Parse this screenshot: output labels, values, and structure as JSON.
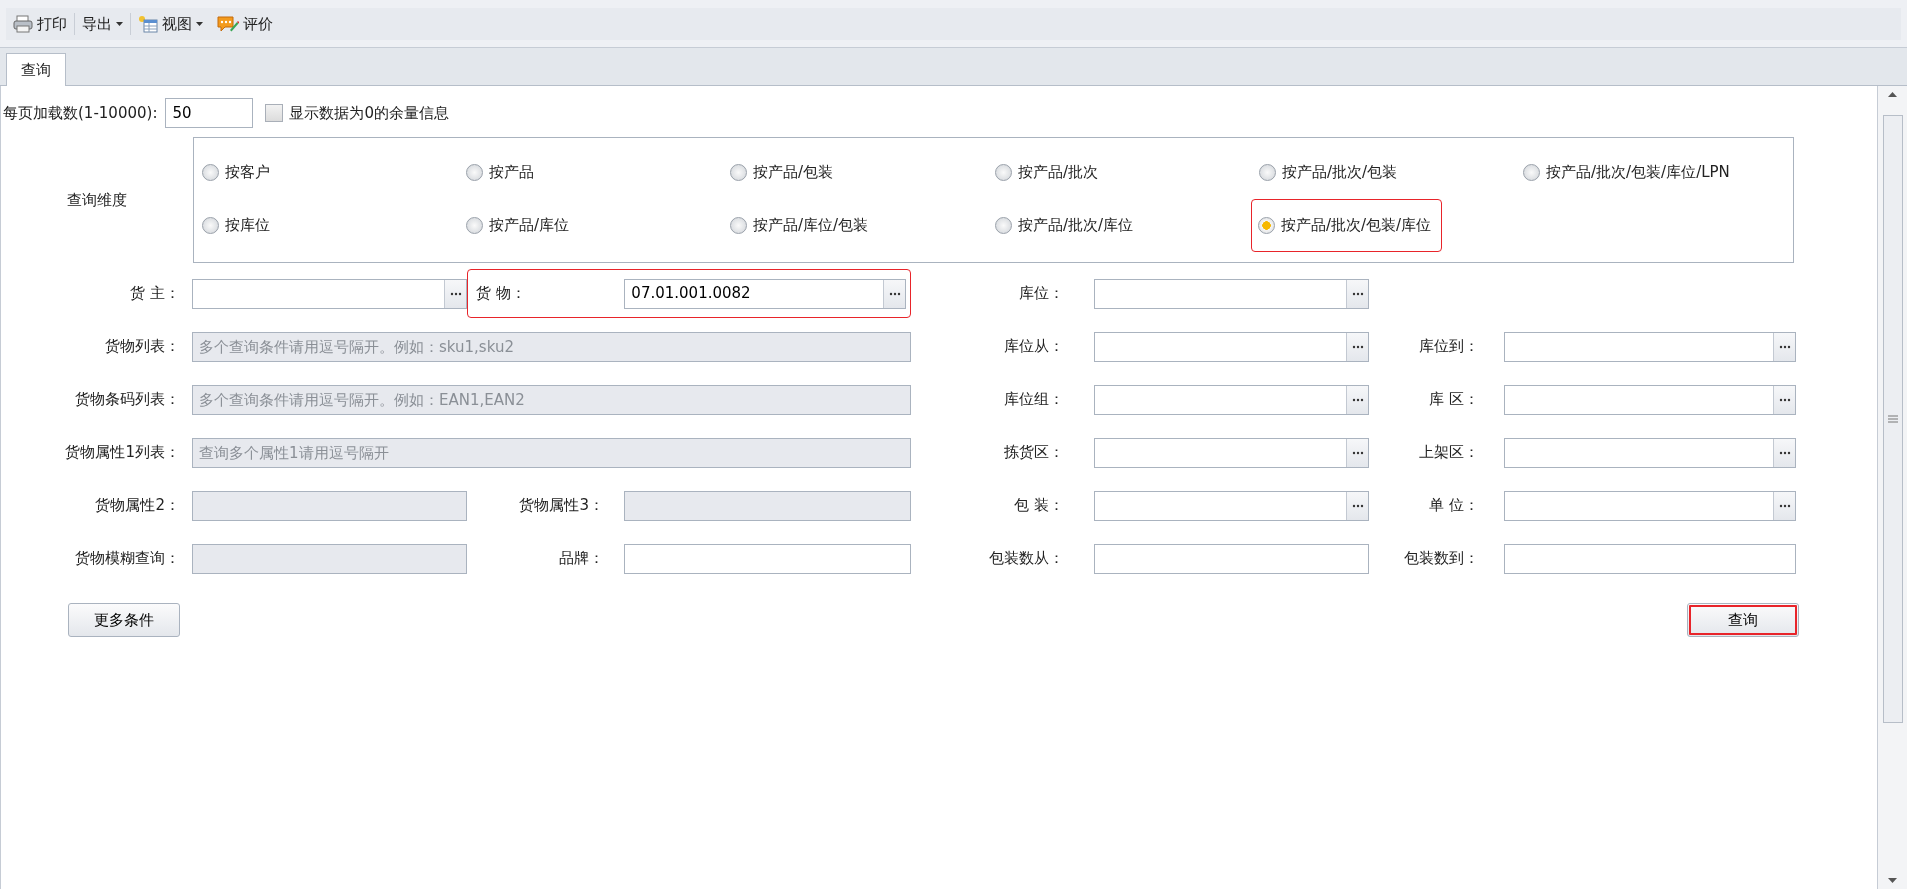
{
  "toolbar": [
    {
      "label": "打印",
      "dropdown": false
    },
    {
      "label": "导出",
      "dropdown": true
    },
    {
      "label": "视图",
      "dropdown": true
    },
    {
      "label": "评价",
      "dropdown": false
    }
  ],
  "tabs": [
    {
      "label": "查询",
      "selected": true
    }
  ],
  "page_size": {
    "label": "每页加载数(1-10000):",
    "value": "50"
  },
  "show_zero": {
    "label": "显示数据为0的余量信息",
    "checked": false
  },
  "dimension": {
    "label": "查询维度",
    "options": [
      {
        "label": "按客户",
        "selected": false
      },
      {
        "label": "按产品",
        "selected": false
      },
      {
        "label": "按产品/包装",
        "selected": false
      },
      {
        "label": "按产品/批次",
        "selected": false
      },
      {
        "label": "按产品/批次/包装",
        "selected": false
      },
      {
        "label": "按产品/批次/包装/库位/LPN",
        "selected": false
      },
      {
        "label": "按库位",
        "selected": false
      },
      {
        "label": "按产品/库位",
        "selected": false
      },
      {
        "label": "按产品/库位/包装",
        "selected": false
      },
      {
        "label": "按产品/批次/库位",
        "selected": false
      },
      {
        "label": "按产品/批次/包装/库位",
        "selected": true,
        "highlighted": true
      }
    ]
  },
  "form_rows": [
    [
      {
        "label": "货 主：",
        "kind": "lookup"
      },
      {
        "label": "货 物：",
        "kind": "lookup",
        "value": "07.01.001.0082",
        "highlighted": true
      },
      {
        "label": "库位：",
        "kind": "lookup"
      }
    ],
    [
      {
        "label": "货物列表：",
        "kind": "readonly",
        "wide": true,
        "placeholder": "多个查询条件请用逗号隔开。例如：sku1,sku2"
      },
      {
        "label": "库位从：",
        "kind": "lookup"
      },
      {
        "label": "库位到：",
        "kind": "lookup"
      }
    ],
    [
      {
        "label": "货物条码列表：",
        "kind": "readonly",
        "wide": true,
        "placeholder": "多个查询条件请用逗号隔开。例如：EAN1,EAN2"
      },
      {
        "label": "库位组：",
        "kind": "lookup"
      },
      {
        "label": "库 区：",
        "kind": "lookup"
      }
    ],
    [
      {
        "label": "货物属性1列表：",
        "kind": "readonly",
        "wide": true,
        "placeholder": "查询多个属性1请用逗号隔开"
      },
      {
        "label": "拣货区：",
        "kind": "lookup"
      },
      {
        "label": "上架区：",
        "kind": "lookup"
      }
    ],
    [
      {
        "label": "货物属性2：",
        "kind": "readonly"
      },
      {
        "label": "货物属性3：",
        "kind": "readonly"
      },
      {
        "label": "包 装：",
        "kind": "lookup"
      },
      {
        "label": "单 位：",
        "kind": "lookup"
      }
    ],
    [
      {
        "label": "货物模糊查询：",
        "kind": "readonly"
      },
      {
        "label": "品牌：",
        "kind": "text"
      },
      {
        "label": "包装数从：",
        "kind": "text"
      },
      {
        "label": "包装数到：",
        "kind": "text"
      }
    ]
  ],
  "more_button": {
    "label": "更多条件"
  },
  "query_button": {
    "label": "查询",
    "highlighted": true
  }
}
